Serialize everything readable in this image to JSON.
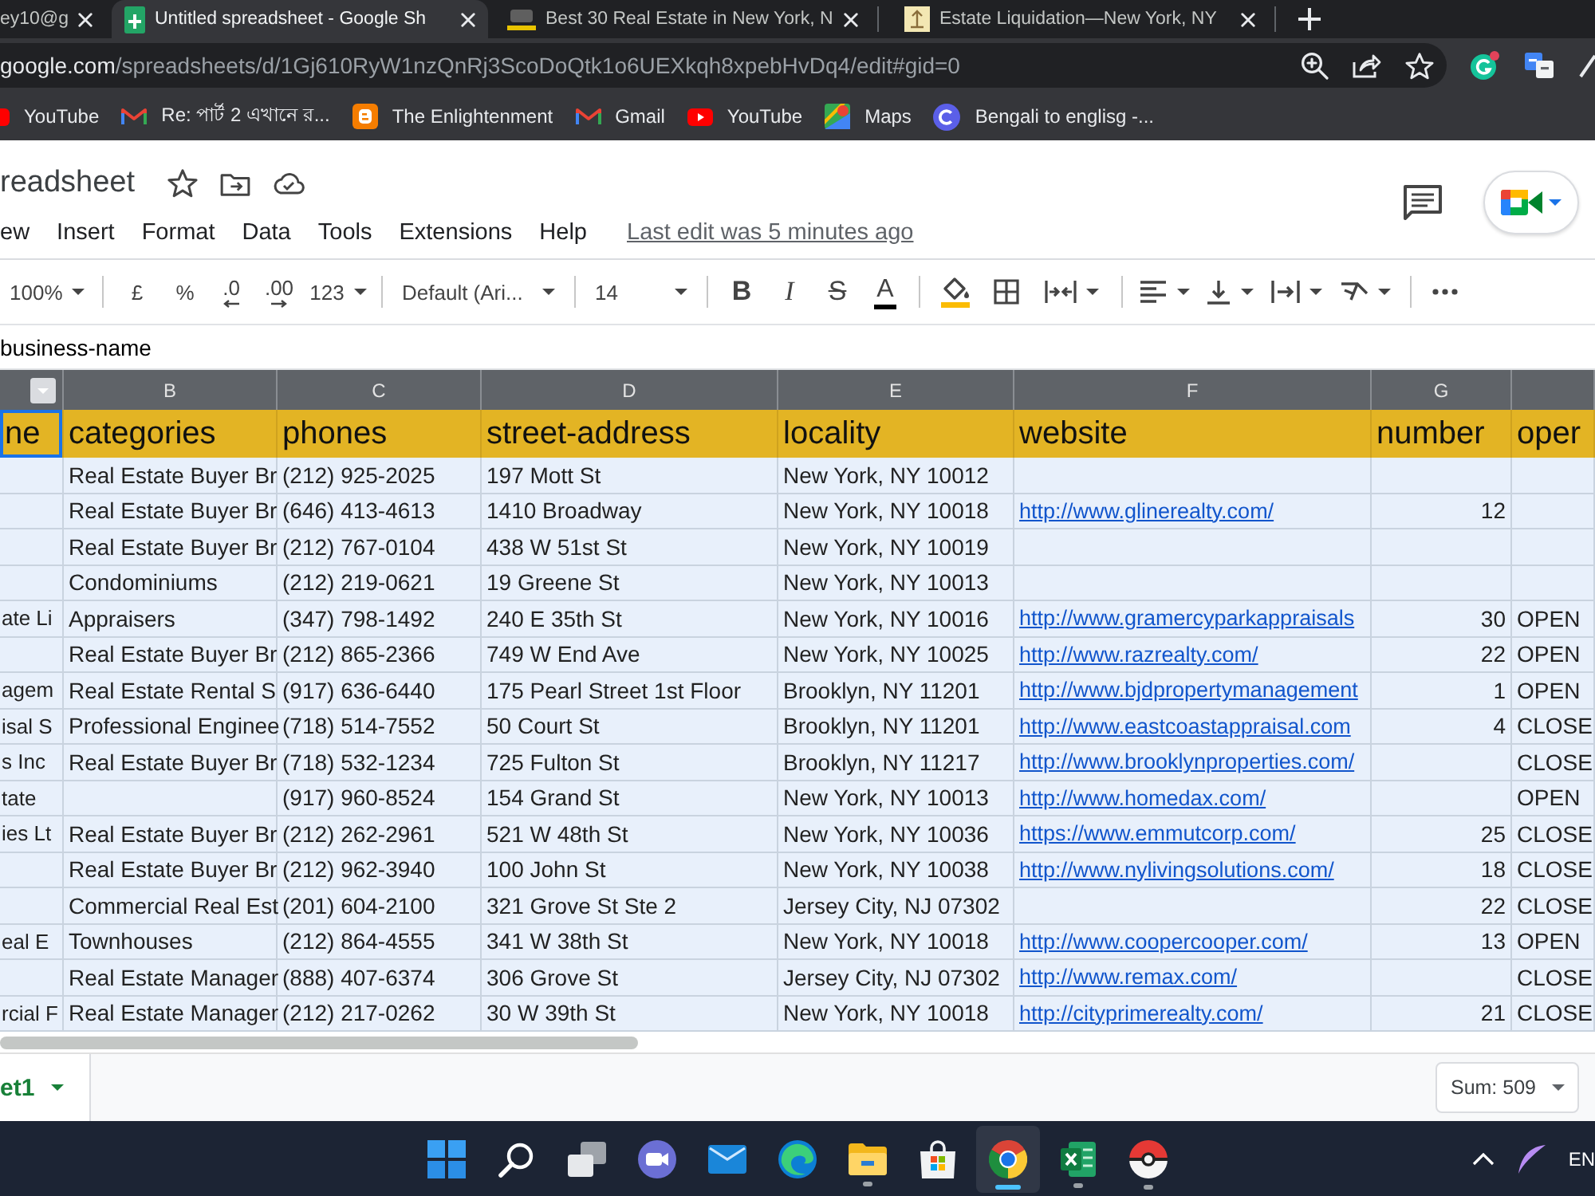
{
  "browser": {
    "tabs": [
      {
        "title": "ey10@g",
        "selected": false,
        "kind": "cut"
      },
      {
        "title": "Untitled spreadsheet - Google Sh",
        "selected": true,
        "kind": "sheets"
      },
      {
        "title": "Best 30 Real Estate in New York, N",
        "selected": false,
        "kind": "yp"
      },
      {
        "title": "Estate Liquidation—New York, NY",
        "selected": false,
        "kind": "estate"
      }
    ],
    "address": {
      "host": "google.com",
      "path": "/spreadsheets/d/1Gj610RyW1nzQnRj3ScoDoQtk1o6UEXkqh8xpebHvDq4/edit#gid=0"
    },
    "bookmarks": [
      {
        "label": "YouTube",
        "kind": "youtube"
      },
      {
        "label": "Re: পার্ট 2 এখানে র...",
        "kind": "gmail"
      },
      {
        "label": "The Enlightenment",
        "kind": "blogger"
      },
      {
        "label": "Gmail",
        "kind": "gmail"
      },
      {
        "label": "YouTube",
        "kind": "youtube"
      },
      {
        "label": "Maps",
        "kind": "maps"
      },
      {
        "label": "Bengali to englisg -...",
        "kind": "letter"
      }
    ]
  },
  "document": {
    "title": "readsheet",
    "menu": [
      "ew",
      "Insert",
      "Format",
      "Data",
      "Tools",
      "Extensions",
      "Help"
    ],
    "last_edit": "Last edit was 5 minutes ago"
  },
  "toolbar": {
    "zoom": "100%",
    "currency": "£",
    "percent": "%",
    "decimal_decrease": ".0",
    "decimal_increase": ".00",
    "number_format": "123",
    "font": "Default (Ari...",
    "font_size": "14",
    "bold": "B",
    "italic": "I",
    "strikethrough": "S",
    "text_color": "A"
  },
  "formula_bar": {
    "value": "business-name"
  },
  "sheet": {
    "columns": [
      {
        "header": "ne",
        "kind": "text",
        "selected": true,
        "filter": true
      },
      {
        "letter": "B",
        "header": "categories",
        "kind": "text",
        "selected": false,
        "filter": false
      },
      {
        "letter": "C",
        "header": "phones",
        "kind": "text",
        "selected": false,
        "filter": false
      },
      {
        "letter": "D",
        "header": "street-address",
        "kind": "text",
        "selected": false,
        "filter": false
      },
      {
        "letter": "E",
        "header": "locality",
        "kind": "text",
        "selected": false,
        "filter": false
      },
      {
        "letter": "F",
        "header": "website",
        "kind": "link",
        "selected": false,
        "filter": false
      },
      {
        "letter": "G",
        "header": "number",
        "kind": "number",
        "selected": false,
        "filter": false
      },
      {
        "header": "oper",
        "kind": "text",
        "selected": false,
        "filter": false
      }
    ],
    "rows": [
      [
        null,
        "Real Estate Buyer Br",
        "(212) 925-2025",
        "197 Mott St",
        "New York, NY 10012",
        null,
        null,
        null
      ],
      [
        null,
        "Real Estate Buyer Br",
        "(646) 413-4613",
        "1410 Broadway",
        "New York, NY 10018",
        "http://www.glinerealty.com/",
        "12",
        null
      ],
      [
        null,
        "Real Estate Buyer Br",
        "(212) 767-0104",
        "438 W 51st St",
        "New York, NY 10019",
        null,
        null,
        null
      ],
      [
        null,
        "Condominiums",
        "(212) 219-0621",
        "19 Greene St",
        "New York, NY 10013",
        null,
        null,
        null
      ],
      [
        "ate Li",
        "Appraisers",
        "(347) 798-1492",
        "240 E 35th St",
        "New York, NY 10016",
        "http://www.gramercyparkappraisals",
        "30",
        "OPEN"
      ],
      [
        null,
        "Real Estate Buyer Br",
        "(212) 865-2366",
        "749 W End Ave",
        "New York, NY 10025",
        "http://www.razrealty.com/",
        "22",
        "OPEN"
      ],
      [
        "agem",
        "Real Estate Rental S",
        "(917) 636-6440",
        "175 Pearl Street 1st Floor",
        "Brooklyn, NY 11201",
        "http://www.bjdpropertymanagement",
        "1",
        "OPEN"
      ],
      [
        "isal S",
        "Professional Enginee",
        "(718) 514-7552",
        "50 Court St",
        "Brooklyn, NY 11201",
        "http://www.eastcoastappraisal.com",
        "4",
        "CLOSE"
      ],
      [
        "s Inc",
        "Real Estate Buyer Br",
        "(718) 532-1234",
        "725 Fulton St",
        "Brooklyn, NY 11217",
        "http://www.brooklynproperties.com/",
        null,
        "CLOSE"
      ],
      [
        "tate",
        null,
        "(917) 960-8524",
        "154 Grand St",
        "New York, NY 10013",
        "http://www.homedax.com/",
        null,
        "OPEN"
      ],
      [
        "ies Lt",
        "Real Estate Buyer Br",
        "(212) 262-2961",
        "521 W 48th St",
        "New York, NY 10036",
        "https://www.emmutcorp.com/",
        "25",
        "CLOSE"
      ],
      [
        null,
        "Real Estate Buyer Br",
        "(212) 962-3940",
        "100 John St",
        "New York, NY 10038",
        "http://www.nylivingsolutions.com/",
        "18",
        "CLOSE"
      ],
      [
        null,
        "Commercial Real Est",
        "(201) 604-2100",
        "321 Grove St Ste 2",
        "Jersey City, NJ 07302",
        null,
        "22",
        "CLOSE"
      ],
      [
        "eal E",
        "Townhouses",
        "(212) 864-4555",
        "341 W 38th St",
        "New York, NY 10018",
        "http://www.coopercooper.com/",
        "13",
        "OPEN"
      ],
      [
        null,
        "Real Estate Manager",
        "(888) 407-6374",
        "306 Grove St",
        "Jersey City, NJ 07302",
        "http://www.remax.com/",
        null,
        "CLOSE"
      ],
      [
        "rcial F",
        "Real Estate Manager",
        "(212) 217-0262",
        "30 W 39th St",
        "New York, NY 10018",
        "http://cityprimerealty.com/",
        "21",
        "CLOSE"
      ]
    ]
  },
  "sheet_tabs": [
    {
      "label": "et1",
      "selected": true
    }
  ],
  "sum": "Sum: 509",
  "taskbar": {
    "apps": [
      {
        "kind": "start",
        "running": false,
        "selected": false
      },
      {
        "kind": "search",
        "running": false,
        "selected": false
      },
      {
        "kind": "task_view",
        "running": false,
        "selected": false
      },
      {
        "kind": "chat",
        "running": false,
        "selected": false
      },
      {
        "kind": "mail",
        "running": false,
        "selected": false
      },
      {
        "kind": "edge",
        "running": false,
        "selected": false
      },
      {
        "kind": "explorer",
        "running": true,
        "selected": false
      },
      {
        "kind": "store",
        "running": false,
        "selected": false
      },
      {
        "kind": "chrome",
        "running": true,
        "selected": true
      },
      {
        "kind": "excel",
        "running": true,
        "selected": false
      },
      {
        "kind": "ball",
        "running": true,
        "selected": false
      }
    ],
    "language": "EN"
  }
}
